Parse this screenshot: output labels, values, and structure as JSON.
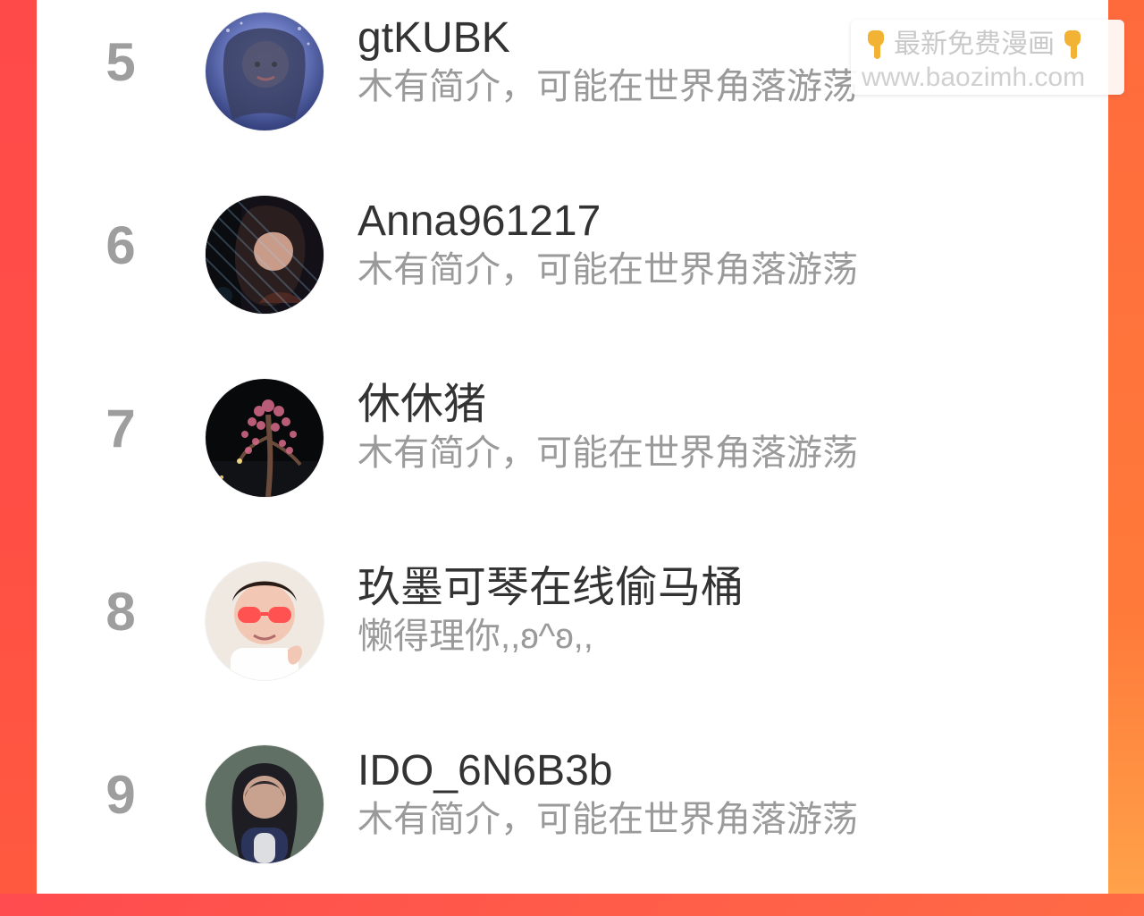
{
  "list": {
    "rows": [
      {
        "rank": "5",
        "name": "gtKUBK",
        "bio": "木有简介，可能在世界角落游荡",
        "avatar": {
          "desc": "avatar-portrait-female-anime",
          "colors": [
            "#1f2b62",
            "#6a79c0",
            "#b7c2ee"
          ]
        }
      },
      {
        "rank": "6",
        "name": "Anna961217",
        "bio": "木有简介，可能在世界角落游荡",
        "avatar": {
          "desc": "avatar-portrait-female-dark",
          "colors": [
            "#0c0c0f",
            "#3a2a2a",
            "#b58a74"
          ]
        }
      },
      {
        "rank": "7",
        "name": "休休猪",
        "bio": "木有简介，可能在世界角落游荡",
        "avatar": {
          "desc": "avatar-night-flowering-tree",
          "colors": [
            "#08090b",
            "#1a1b22",
            "#d76b8b"
          ]
        }
      },
      {
        "rank": "8",
        "name": "玖墨可琴在线偷马桶",
        "bio": "懒得理你,,ʚ^ʚ,,",
        "avatar": {
          "desc": "avatar-child-sunglasses",
          "colors": [
            "#efe9e2",
            "#2a1b15",
            "#ff4c4c"
          ]
        }
      },
      {
        "rank": "9",
        "name": "IDO_6N6B3b",
        "bio": "木有简介，可能在世界角落游荡",
        "avatar": {
          "desc": "avatar-portrait-female-gray",
          "colors": [
            "#607064",
            "#1e1d24",
            "#a58c7d"
          ]
        }
      }
    ]
  },
  "watermark": {
    "top_text": "最新免费漫画",
    "bottom_text": "www.baozimh.com",
    "icon_left": "pointing-hand-icon",
    "icon_right": "pointing-hand-icon"
  },
  "theme": {
    "accent_red": "#ff4b4f",
    "accent_orange": "#ff8a3c",
    "rank_gray": "#9e9e9e",
    "name_dark": "#333333",
    "bio_gray": "#9a9a9a"
  }
}
